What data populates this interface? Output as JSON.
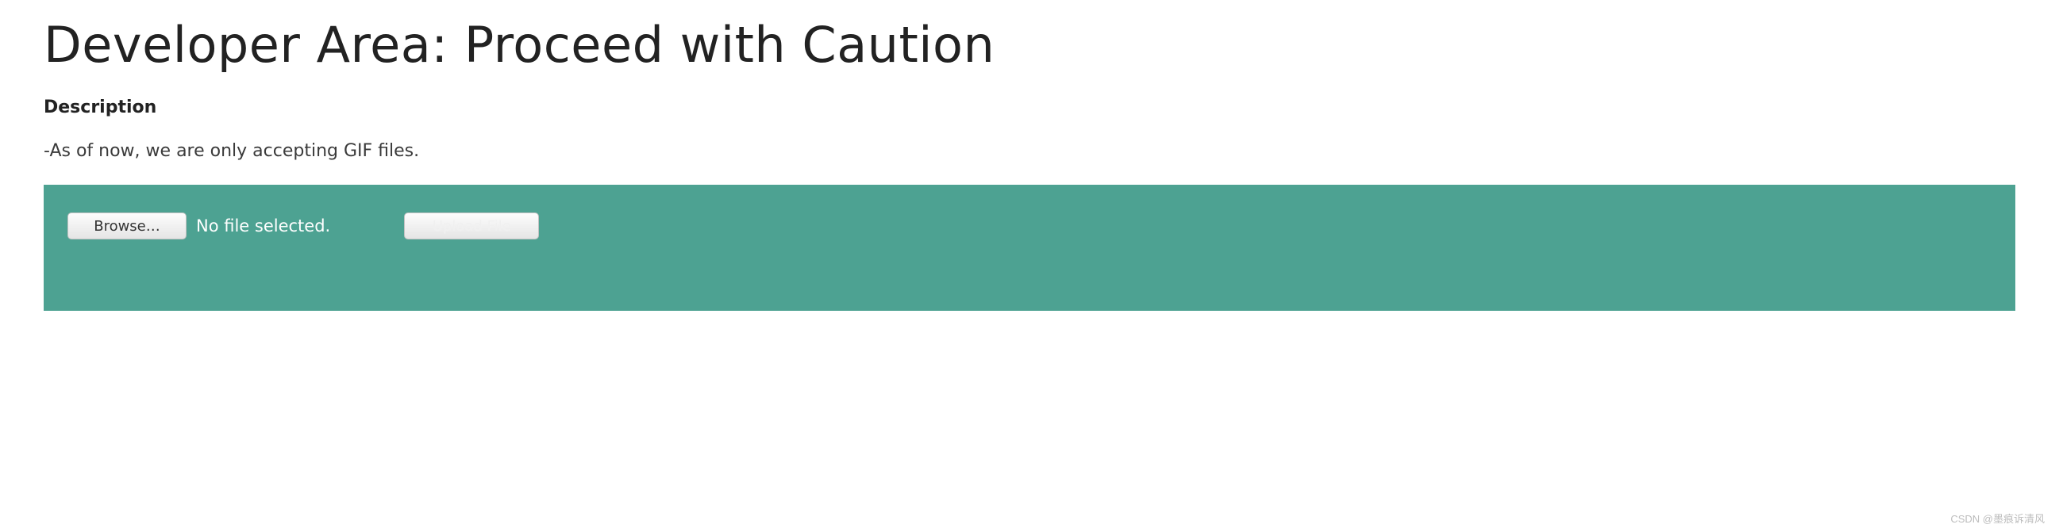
{
  "header": {
    "title": "Developer Area: Proceed with Caution"
  },
  "section": {
    "label": "Description",
    "text": "-As of now, we are only accepting GIF files."
  },
  "upload": {
    "browse_label": "Browse…",
    "file_status": "No file selected.",
    "submit_label": "Upload File"
  },
  "watermark": "CSDN @墨痕诉清风",
  "colors": {
    "panel_bg": "#4da292"
  }
}
